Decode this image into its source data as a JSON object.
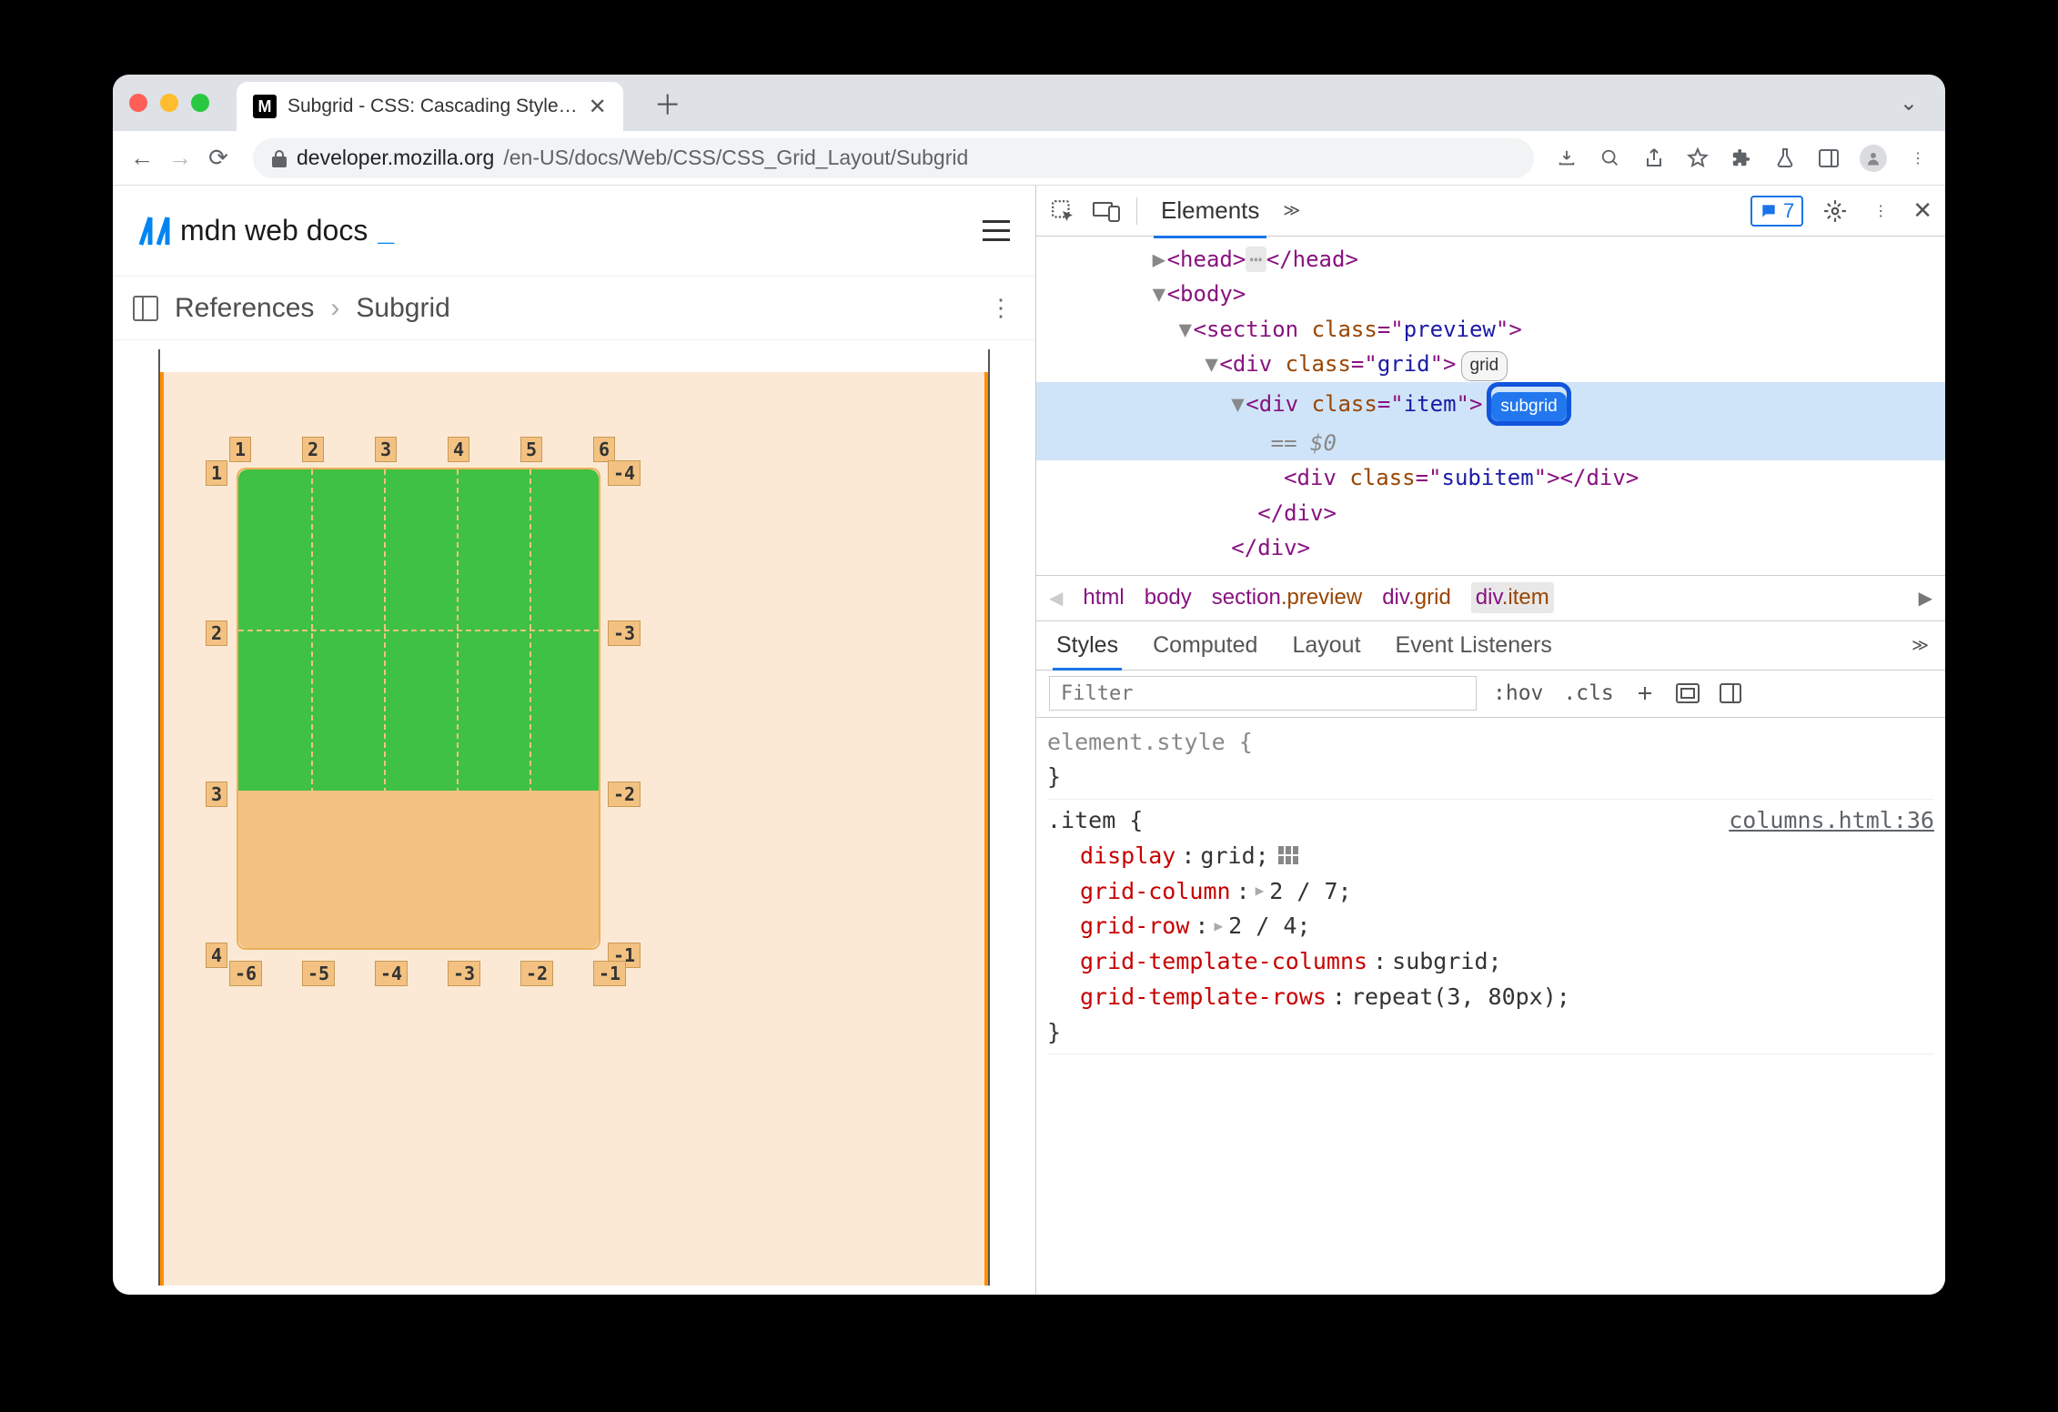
{
  "tab": {
    "title": "Subgrid - CSS: Cascading Style…",
    "favicon": "M"
  },
  "url": {
    "domain": "developer.mozilla.org",
    "path": "/en-US/docs/Web/CSS/CSS_Grid_Layout/Subgrid"
  },
  "mdn": {
    "brand": "mdn web docs"
  },
  "breadcrumb": {
    "a": "References",
    "b": "Subgrid"
  },
  "grid_labels": {
    "top": [
      "1",
      "2",
      "3",
      "4",
      "5",
      "6"
    ],
    "left": [
      "1",
      "2",
      "3",
      "4"
    ],
    "right": [
      "-4",
      "-3",
      "-2",
      "-1"
    ],
    "bottom": [
      "-6",
      "-5",
      "-4",
      "-3",
      "-2",
      "-1"
    ]
  },
  "devtools": {
    "tab_elements": "Elements",
    "issue_count": "7",
    "dom": {
      "head_open": "<head>",
      "head_close": "</head>",
      "body_open": "<body>",
      "section_open": "<section class=\"preview\">",
      "grid_open": "<div class=\"grid\">",
      "grid_badge": "grid",
      "item_open": "<div class=\"item\">",
      "subgrid_badge": "subgrid",
      "console": "== $0",
      "subitem": "<div class=\"subitem\"></div>",
      "div_close": "</div>"
    },
    "crumbs": [
      "html",
      "body",
      "section.preview",
      "div.grid",
      "div.item"
    ],
    "styles_tabs": [
      "Styles",
      "Computed",
      "Layout",
      "Event Listeners"
    ],
    "filter_placeholder": "Filter",
    "filter_buttons": {
      "hov": ":hov",
      "cls": ".cls"
    },
    "styles": {
      "element_style": "element.style {",
      "close": "}",
      "item_sel": ".item {",
      "item_src": "columns.html:36",
      "lines": [
        {
          "prop": "display",
          "val": "grid;",
          "grid_icon": true
        },
        {
          "prop": "grid-column",
          "val": "2 / 7;",
          "tri": true
        },
        {
          "prop": "grid-row",
          "val": "2 / 4;",
          "tri": true
        },
        {
          "prop": "grid-template-columns",
          "val": "subgrid;"
        },
        {
          "prop": "grid-template-rows",
          "val": "repeat(3, 80px);"
        }
      ]
    }
  }
}
